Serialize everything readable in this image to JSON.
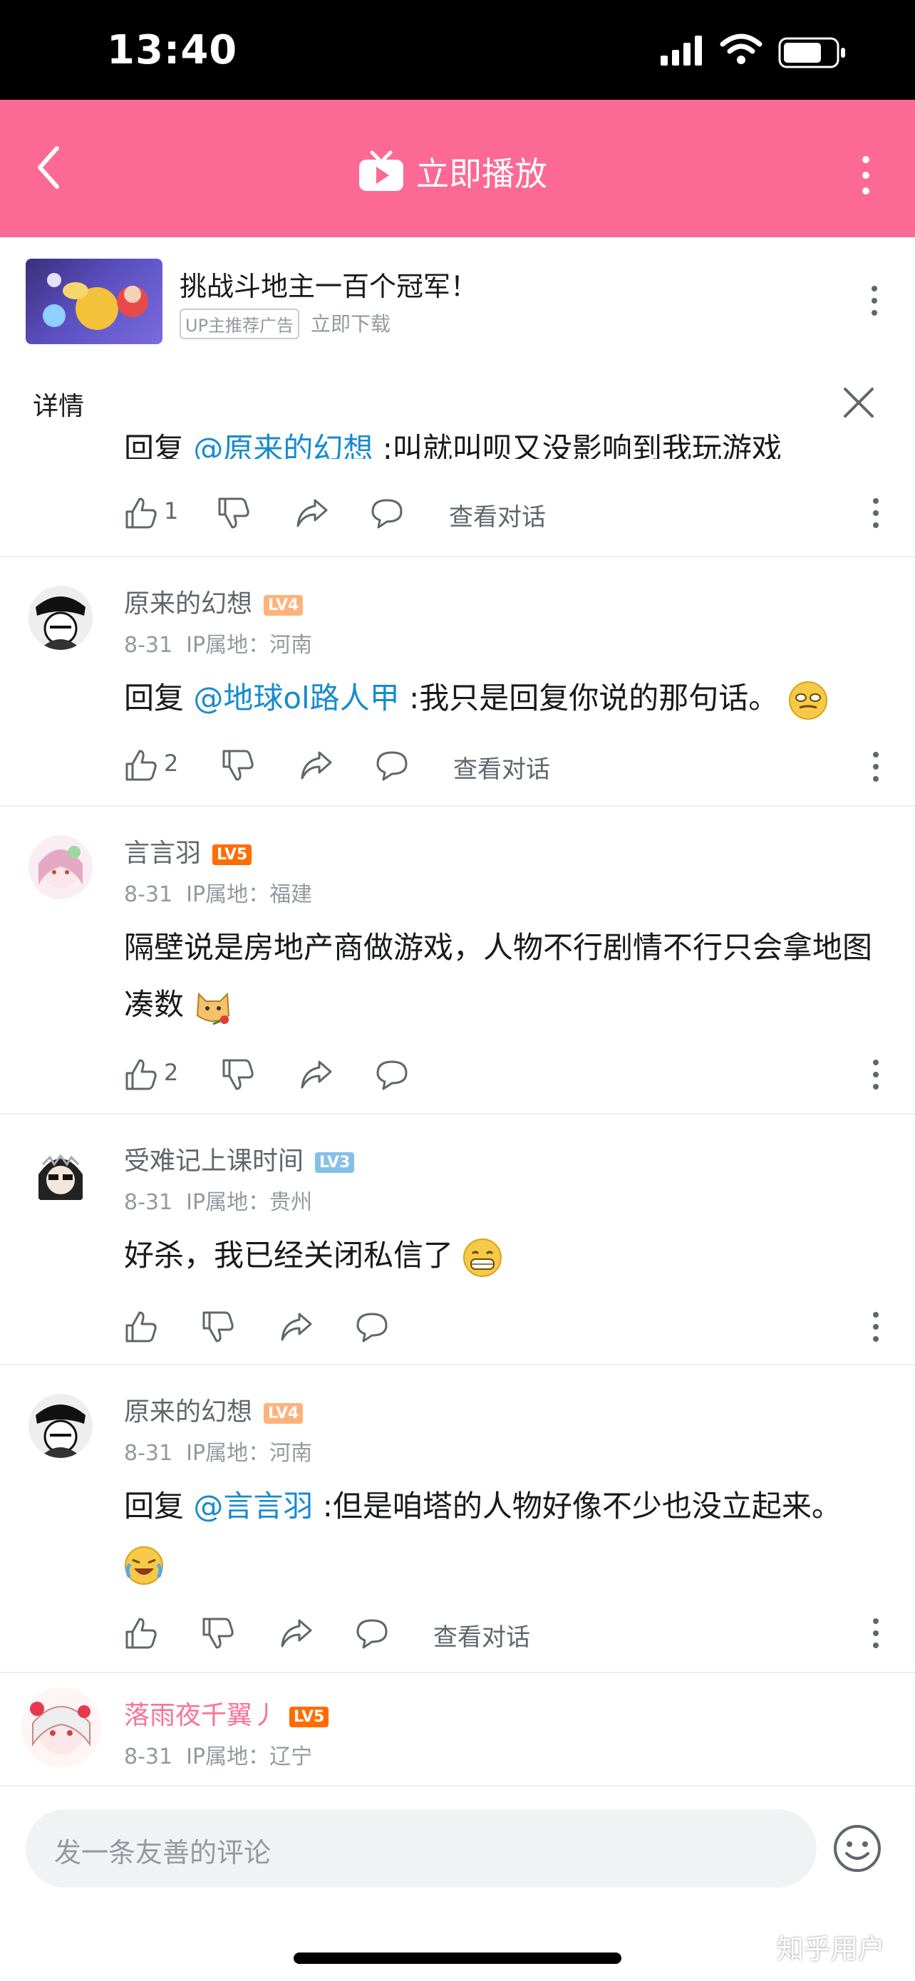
{
  "status_bar": {
    "time": "13:40"
  },
  "nav": {
    "title": "立即播放"
  },
  "ad": {
    "title": "挑战斗地主一百个冠军！",
    "tag": "UP主推荐广告",
    "action": "立即下载"
  },
  "detail": {
    "label": "详情"
  },
  "partial_comment": {
    "reply": "回复 ",
    "mention": "@原来的幻想",
    "text": " :叫就叫呗又没影响到我玩游戏",
    "likes": "1",
    "view": "查看对话"
  },
  "comments": [
    {
      "user": "原来的幻想",
      "level": "LV4",
      "date": "8-31",
      "ip": "IP属地：河南",
      "reply": "回复 ",
      "mention": "@地球ol路人甲",
      "text": " :我只是回复你说的那句话。",
      "likes": "2",
      "view": "查看对话"
    },
    {
      "user": "言言羽",
      "level": "LV5",
      "date": "8-31",
      "ip": "IP属地：福建",
      "text": "隔壁说是房地产商做游戏，人物不行剧情不行只会拿地图凑数",
      "likes": "2"
    },
    {
      "user": "受难记上课时间",
      "level": "LV3",
      "date": "8-31",
      "ip": "IP属地：贵州",
      "text": "好杀，我已经关闭私信了",
      "likes": ""
    },
    {
      "user": "原来的幻想",
      "level": "LV4",
      "date": "8-31",
      "ip": "IP属地：河南",
      "reply": "回复 ",
      "mention": "@言言羽",
      "text": " :但是咱塔的人物好像不少也没立起来。",
      "likes": "",
      "view": "查看对话"
    },
    {
      "user": "落雨夜千翼丿",
      "level": "LV5",
      "date": "8-31",
      "ip": "IP属地：辽宁"
    }
  ],
  "input": {
    "placeholder": "发一条友善的评论"
  },
  "watermark": "知乎用户",
  "colors": {
    "brand": "#fb6994",
    "link": "#178bcf",
    "lv3": "#84c0e8",
    "lv4": "#ffb27a",
    "lv5": "#ff6c00"
  }
}
